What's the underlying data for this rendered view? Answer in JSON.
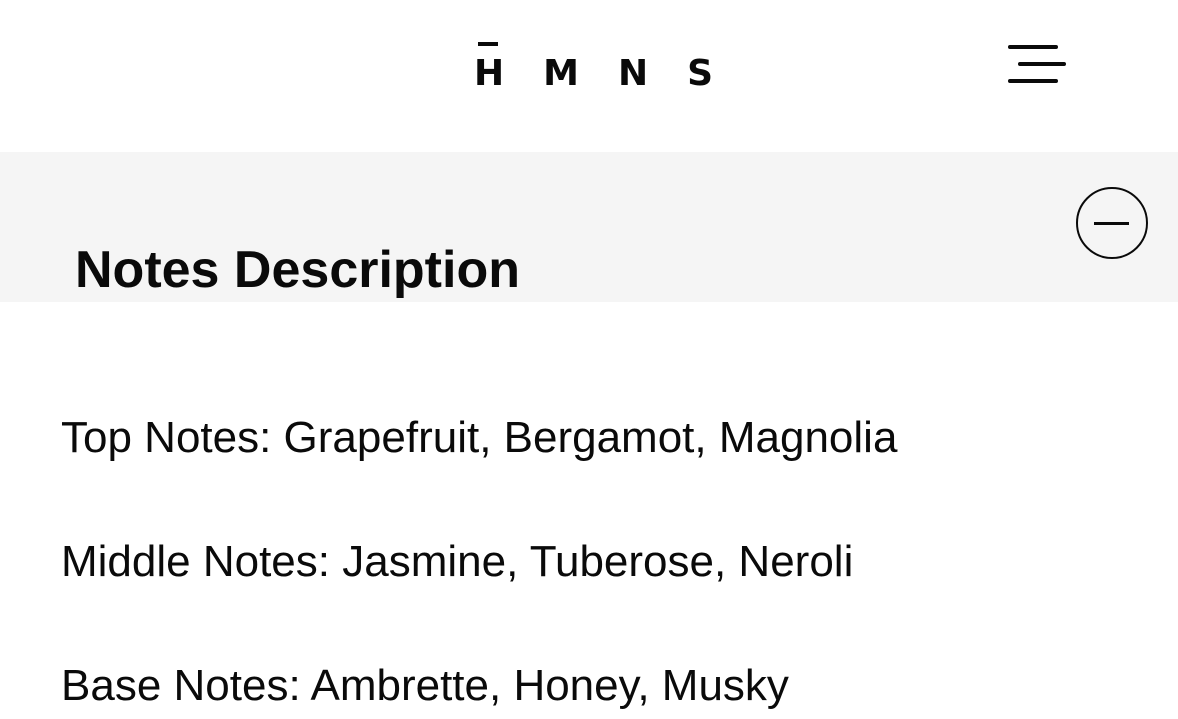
{
  "header": {
    "logo": {
      "letters": [
        "H",
        "M",
        "N",
        "S"
      ]
    },
    "menu_icon": "hamburger-menu-icon"
  },
  "accordion": {
    "title": "Notes Description",
    "toggle_icon": "minus-circle-icon",
    "expanded": true
  },
  "notes": {
    "top": "Top Notes: Grapefruit, Bergamot, Magnolia",
    "middle": "Middle Notes: Jasmine, Tuberose, Neroli",
    "base": "Base Notes: Ambrette, Honey, Musky"
  },
  "colors": {
    "text": "#0a0a0a",
    "accordion_background": "#f5f5f5",
    "page_background": "#ffffff"
  }
}
